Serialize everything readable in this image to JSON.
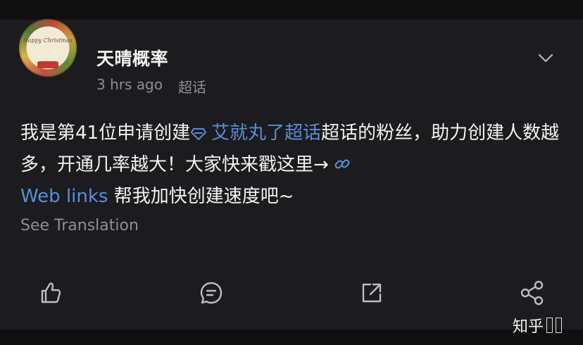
{
  "post": {
    "author": "天晴概率",
    "time": "3 hrs ago",
    "source": "超话",
    "text_before_topic": "我是第41位申请创建",
    "topic_label": "艾就丸了超话",
    "text_after_topic": "超话的粉丝，助力创建人数越多，开通几率越大！大家快来戳这里→",
    "link_label": "Web links",
    "text_after_link": " 帮我加快创建速度吧~",
    "see_translation": "See Translation"
  },
  "avatar": {
    "text": "Happy Christmas"
  },
  "icons": {
    "menu": "chevron-down-icon",
    "topic": "diamond-icon",
    "link": "link-icon",
    "like": "thumbs-up-icon",
    "comment": "comment-icon",
    "share": "share-out-icon",
    "more": "share-nodes-icon"
  },
  "watermark": {
    "text": "知乎"
  },
  "colors": {
    "background": "#1c1c1e",
    "text": "#f2f2f2",
    "muted": "#8e8e93",
    "link": "#5a8dd8"
  }
}
